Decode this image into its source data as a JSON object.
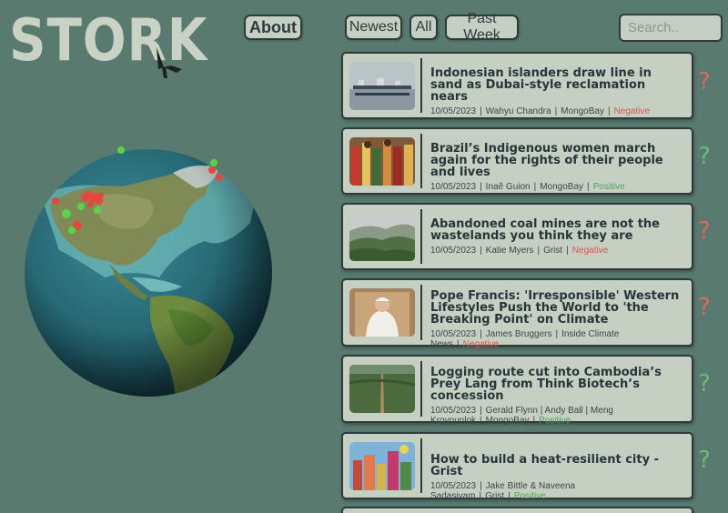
{
  "brand": {
    "name": "STORK"
  },
  "nav": {
    "about": "About",
    "newest": "Newest",
    "all": "All",
    "past_week": "Past Week",
    "search_placeholder": "Search.."
  },
  "globe": {
    "ocean_color": "#2a6f7d",
    "marker_negative": "#e8453c",
    "marker_positive": "#58d44a"
  },
  "articles": [
    {
      "title": "Indonesian islanders draw line in sand as Dubai-style reclamation nears",
      "date": "10/05/2023",
      "authors": "Wahyu Chandra",
      "source": "MongoBay",
      "sentiment": "Negative",
      "mark": "?",
      "thumb": "boats-icon"
    },
    {
      "title": "Brazil’s Indigenous women march again for the rights of their people and lives",
      "date": "10/05/2023",
      "authors": "Inaê Guion",
      "source": "MongoBay",
      "sentiment": "Positive",
      "mark": "?",
      "thumb": "march-icon"
    },
    {
      "title": "Abandoned coal mines are not the wastelands you think they are",
      "date": "10/05/2023",
      "authors": "Katie Myers",
      "source": "Grist",
      "sentiment": "Negative",
      "mark": "?",
      "thumb": "forest-icon"
    },
    {
      "title": "Pope Francis: 'Irresponsible' Western Lifestyles Push the World to 'the Breaking Point' on Climate",
      "date": "10/05/2023",
      "authors": "James Bruggers",
      "source": "Inside Climate News",
      "sentiment": "Negative",
      "mark": "?",
      "thumb": "pope-icon"
    },
    {
      "title": "Logging route cut into Cambodia’s Prey Lang from Think Biotech’s concession",
      "date": "10/05/2023",
      "authors": "Gerald Flynn | Andy Ball | Meng Kroypunlok",
      "source": "MongoBay",
      "sentiment": "Positive",
      "mark": "?",
      "thumb": "road-icon"
    },
    {
      "title": "How to build a heat-resilient city - Grist",
      "date": "10/05/2023",
      "authors": "Jake Bittle & Naveena Sadasivam",
      "source": "Grist",
      "sentiment": "Positive",
      "mark": "?",
      "thumb": "city-icon"
    }
  ]
}
